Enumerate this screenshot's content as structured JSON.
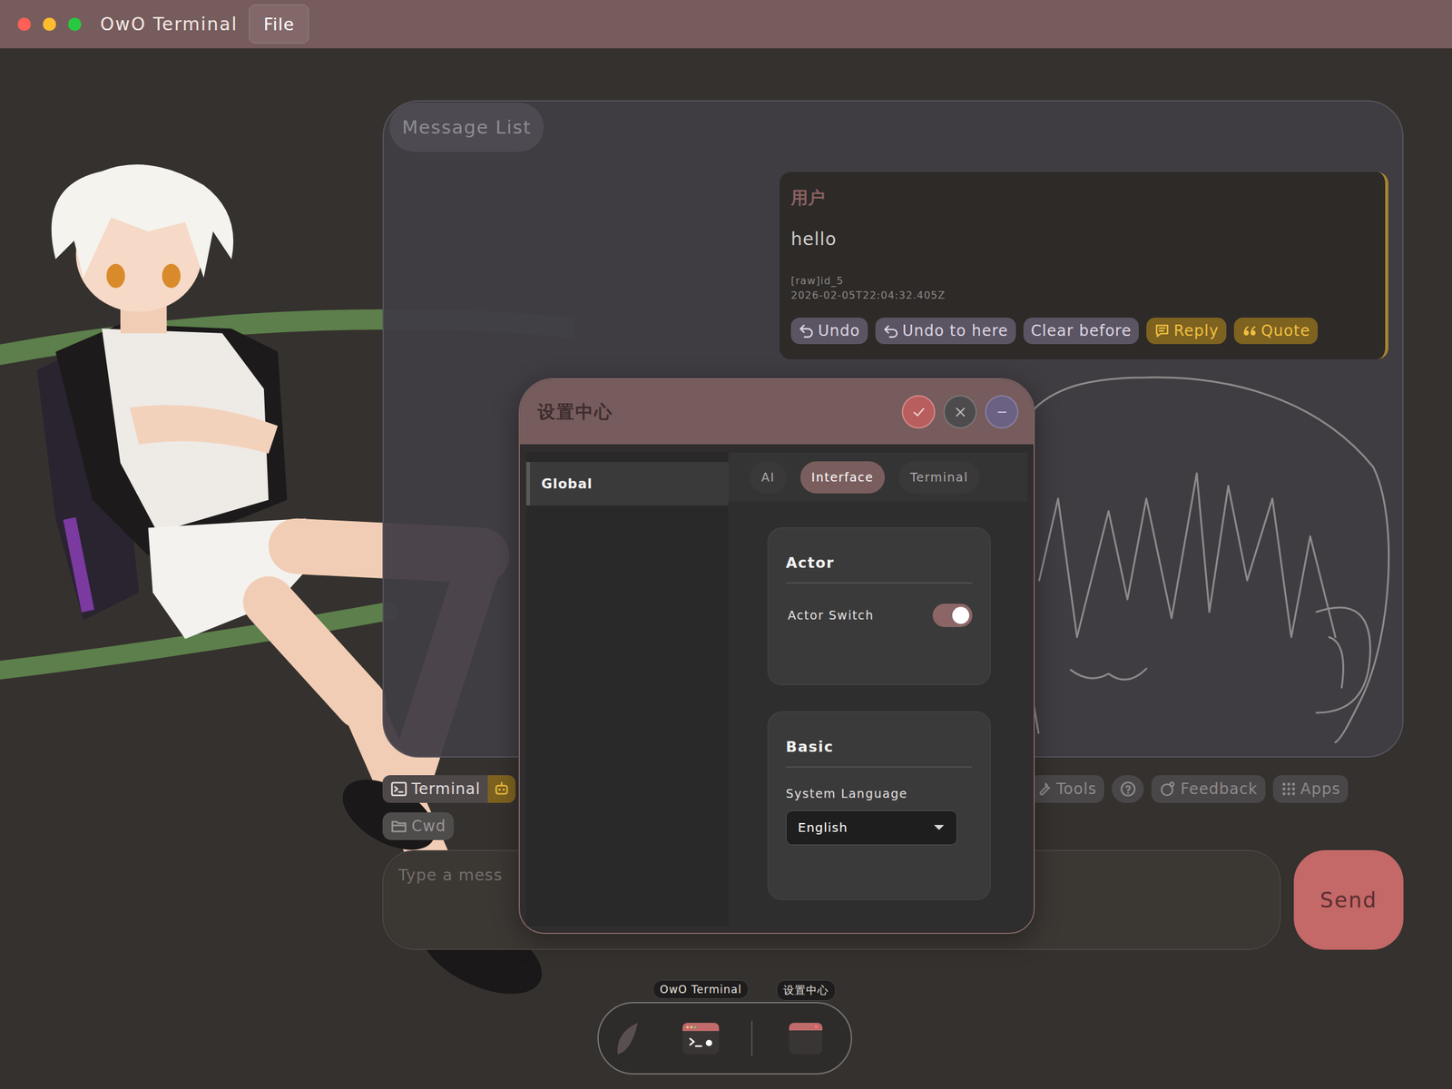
{
  "window": {
    "title": "OwO Terminal"
  },
  "menu": [
    {
      "label": "File"
    }
  ],
  "message_list": {
    "title": "Message List",
    "messages": [
      {
        "author": "用户",
        "text": "hello",
        "meta": [
          "[raw]id_5",
          "2026-02-05T22:04:32.405Z"
        ],
        "actions": [
          {
            "label": "Undo",
            "kind": "plain"
          },
          {
            "label": "Undo to here",
            "kind": "plain"
          },
          {
            "label": "Clear before",
            "kind": "plain"
          },
          {
            "label": "Reply",
            "kind": "accent"
          },
          {
            "label": "Quote",
            "kind": "accent"
          }
        ]
      }
    ]
  },
  "toolbar": {
    "left": [
      {
        "label": "Terminal",
        "kind": "primary"
      },
      {
        "kind": "accent-icon"
      }
    ],
    "right": [
      {
        "label": "Tools",
        "kind": "labeled"
      },
      {
        "kind": "icon"
      },
      {
        "label": "Feedback",
        "kind": "labeled"
      },
      {
        "label": "Apps",
        "kind": "labeled"
      }
    ]
  },
  "cwd": {
    "label": "Cwd"
  },
  "composer": {
    "placeholder": "Type a mess",
    "send": "Send"
  },
  "settings": {
    "title": "设置中心",
    "sidebar": [
      {
        "label": "Global",
        "selected": true
      }
    ],
    "tabs": [
      {
        "label": "AI",
        "selected": false
      },
      {
        "label": "Interface",
        "selected": true
      },
      {
        "label": "Terminal",
        "selected": false
      }
    ],
    "sections": [
      {
        "title": "Actor",
        "fields": [
          {
            "kind": "toggle",
            "label": "Actor Switch",
            "on": true
          }
        ]
      },
      {
        "title": "Basic",
        "fields": [
          {
            "kind": "select",
            "label": "System Language",
            "value": "English"
          }
        ]
      }
    ]
  },
  "dock": {
    "apps": [
      {
        "label": "OwO Terminal"
      },
      {
        "label": "设置中心"
      }
    ]
  }
}
